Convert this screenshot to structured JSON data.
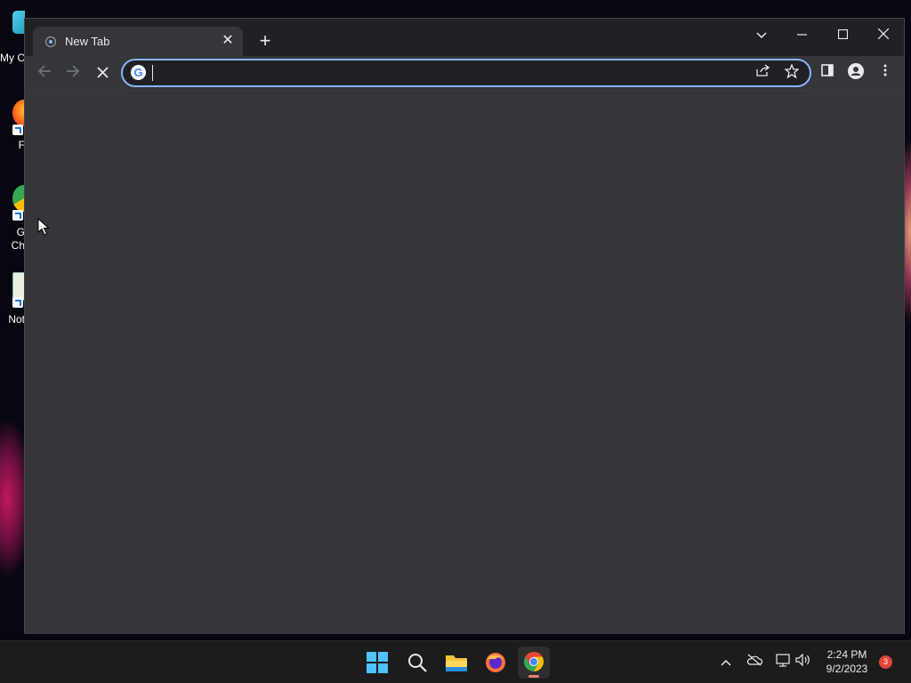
{
  "desktop": {
    "icons": [
      {
        "name": "desktop-icon-my-computer",
        "label": "My C"
      },
      {
        "name": "desktop-icon-firefox",
        "label": "F"
      },
      {
        "name": "desktop-icon-chrome",
        "label": "G\nCh"
      },
      {
        "name": "desktop-icon-notepad",
        "label": "Not"
      }
    ]
  },
  "browser": {
    "tab": {
      "title": "New Tab",
      "favicon": "chrome-newtab-icon",
      "close_icon": "close-icon"
    },
    "new_tab_icon": "plus-icon",
    "window_controls": {
      "tab_search": "chevron-down-icon",
      "minimize": "minimize-icon",
      "maximize": "maximize-icon",
      "close": "close-icon"
    },
    "toolbar": {
      "back": "arrow-left-icon",
      "forward": "arrow-right-icon",
      "stop": "stop-loading-icon",
      "omnibox": {
        "value": "",
        "placeholder": "",
        "search_engine_icon": "google-icon"
      },
      "share": "share-icon",
      "bookmark": "star-icon",
      "side_panel": "side-panel-icon",
      "profile": "profile-icon",
      "menu": "kebab-menu-icon"
    },
    "accent_color": "#8ab4f8",
    "background_color": "#35363a"
  },
  "taskbar": {
    "apps": [
      "windows-start-icon",
      "search-icon",
      "file-explorer-icon",
      "firefox-icon",
      "chrome-icon"
    ],
    "active_app": "chrome-icon",
    "tray": [
      "chevron-up-icon",
      "onedrive-offline-icon",
      "network-icon",
      "volume-icon"
    ],
    "time": "2:24 PM",
    "date": "9/2/2023",
    "notification_count": "3"
  }
}
